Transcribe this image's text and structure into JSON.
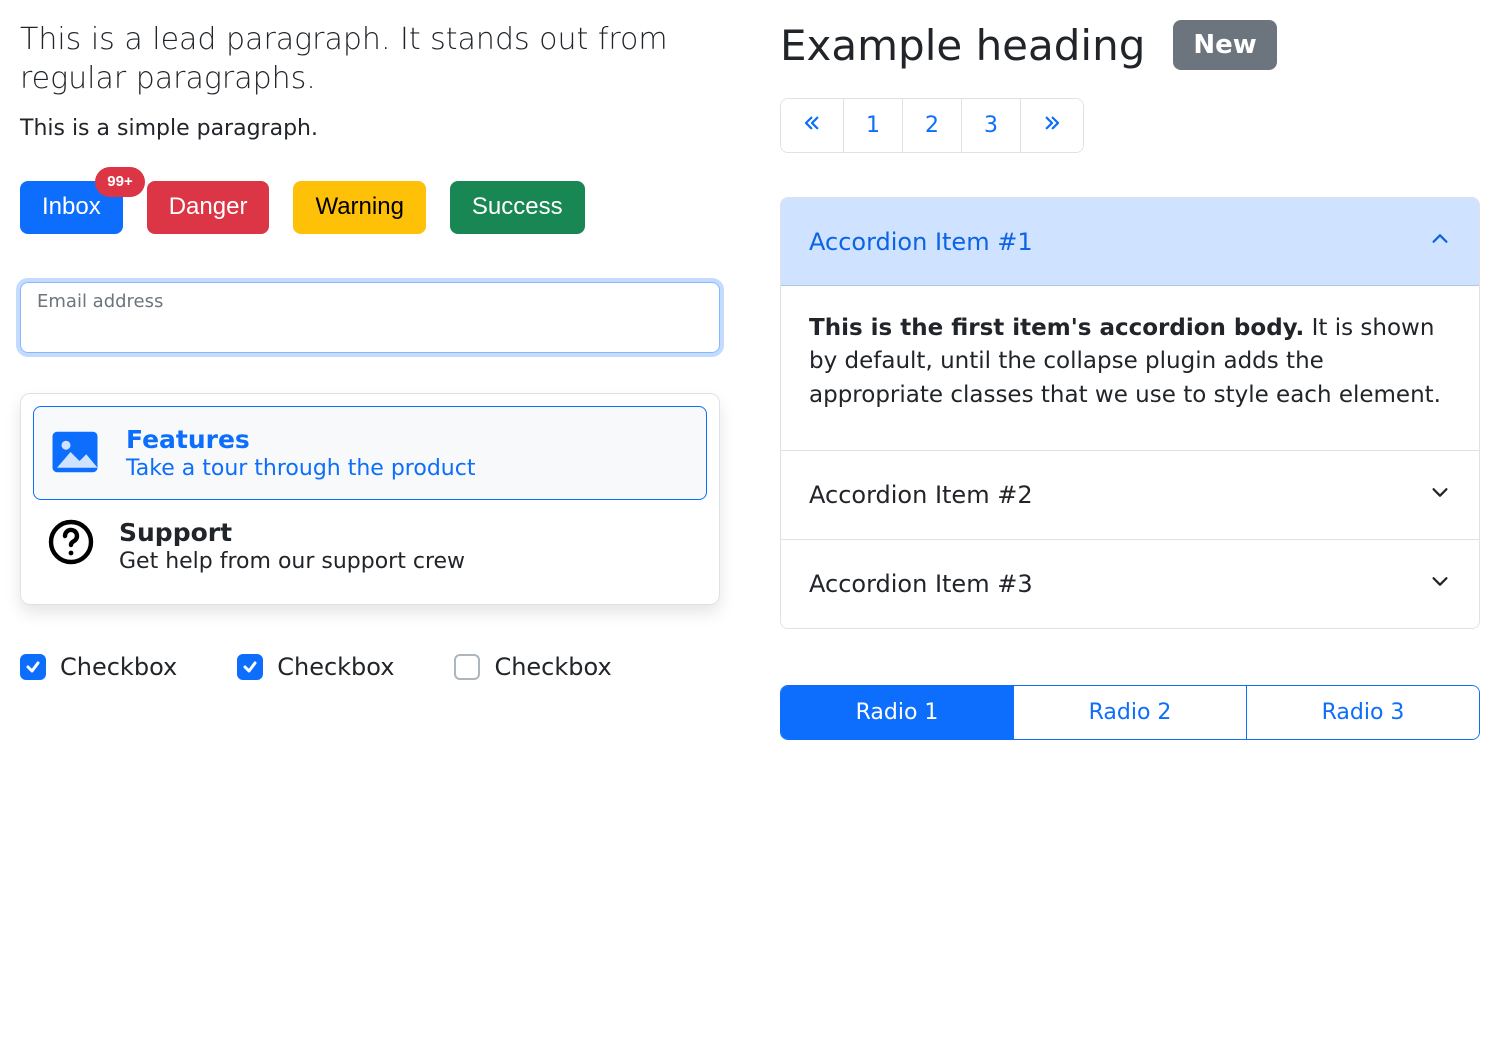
{
  "left": {
    "lead": "This is a lead paragraph. It stands out from regular paragraphs.",
    "simple": "This is a simple paragraph.",
    "buttons": {
      "inbox": "Inbox",
      "inbox_badge": "99+",
      "danger": "Danger",
      "warning": "Warning",
      "success": "Success"
    },
    "email_label": "Email address",
    "list": {
      "features": {
        "title": "Features",
        "sub": "Take a tour through the product"
      },
      "support": {
        "title": "Support",
        "sub": "Get help from our support crew"
      }
    },
    "checkbox_label": "Checkbox"
  },
  "right": {
    "heading": "Example heading",
    "badge": "New",
    "pagination": {
      "p1": "1",
      "p2": "2",
      "p3": "3"
    },
    "accordion": {
      "item1": "Accordion Item #1",
      "item2": "Accordion Item #2",
      "item3": "Accordion Item #3",
      "body1_bold": "This is the first item's accordion body.",
      "body1_rest": " It is shown by default, until the collapse plugin adds the appropriate classes that we use to style each element."
    },
    "radios": {
      "r1": "Radio 1",
      "r2": "Radio 2",
      "r3": "Radio 3"
    }
  }
}
